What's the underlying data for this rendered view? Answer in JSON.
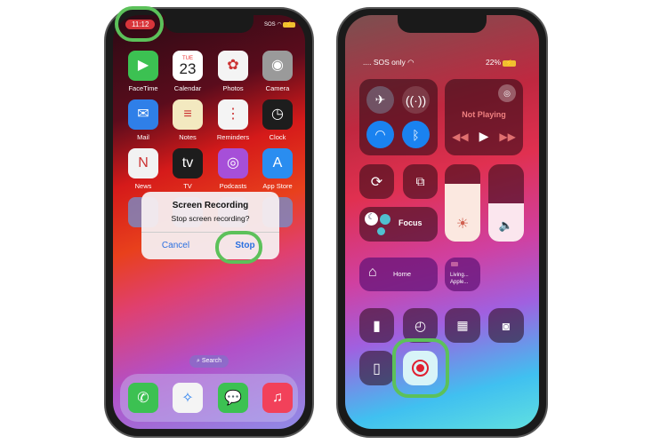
{
  "left_phone": {
    "status": {
      "time": "11:12",
      "carrier": "SOS"
    },
    "apps": [
      {
        "label": "FaceTime",
        "color": "#3cc152",
        "glyph": "▶"
      },
      {
        "label": "Calendar",
        "color": "#ffffff",
        "glyph": "23",
        "day": "TUE"
      },
      {
        "label": "Photos",
        "color": "#f4f4f4",
        "glyph": "✿"
      },
      {
        "label": "Camera",
        "color": "#9a9a9a",
        "glyph": "◉"
      },
      {
        "label": "Mail",
        "color": "#2f7fe8",
        "glyph": "✉"
      },
      {
        "label": "Notes",
        "color": "#f3e9c0",
        "glyph": "≡"
      },
      {
        "label": "Reminders",
        "color": "#f4f4f4",
        "glyph": "⋮"
      },
      {
        "label": "Clock",
        "color": "#1d1d1d",
        "glyph": "◷"
      },
      {
        "label": "News",
        "color": "#f2f2f2",
        "glyph": "N"
      },
      {
        "label": "TV",
        "color": "#1d1d1d",
        "glyph": "tv"
      },
      {
        "label": "Podcasts",
        "color": "#a64fd8",
        "glyph": "◎"
      },
      {
        "label": "App Store",
        "color": "#2a8df0",
        "glyph": "A"
      }
    ],
    "dialog": {
      "title": "Screen Recording",
      "message": "Stop screen recording?",
      "cancel": "Cancel",
      "stop": "Stop"
    },
    "search": "Search",
    "dock": [
      {
        "name": "phone",
        "color": "#3cc152",
        "glyph": "✆"
      },
      {
        "name": "safari",
        "color": "#f4f4f4",
        "glyph": "✧"
      },
      {
        "name": "messages",
        "color": "#3cc152",
        "glyph": "💬"
      },
      {
        "name": "music",
        "color": "#f2415a",
        "glyph": "♫"
      }
    ]
  },
  "right_phone": {
    "status": {
      "carrier": "SOS only",
      "battery": "22%"
    },
    "media": {
      "title": "Not Playing"
    },
    "focus": "Focus",
    "home": "Home",
    "living": "Living... Apple...",
    "brightness_level": 0.75,
    "volume_level": 0.5
  },
  "highlight_color": "#5cc15a"
}
